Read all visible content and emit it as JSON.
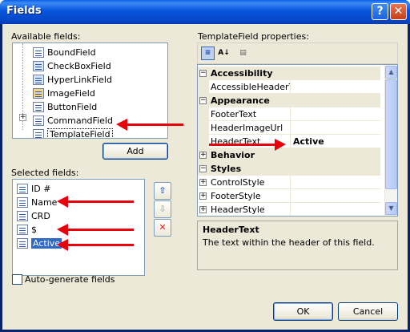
{
  "window": {
    "title": "Fields",
    "help_glyph": "?",
    "close_glyph": "✕"
  },
  "available": {
    "label": "Available fields:",
    "items": [
      {
        "label": "BoundField",
        "icon": "bound-field-icon"
      },
      {
        "label": "CheckBoxField",
        "icon": "checkbox-field-icon"
      },
      {
        "label": "HyperLinkField",
        "icon": "hyperlink-field-icon"
      },
      {
        "label": "ImageField",
        "icon": "image-field-icon"
      },
      {
        "label": "ButtonField",
        "icon": "button-field-icon"
      },
      {
        "label": "CommandField",
        "icon": "command-field-icon"
      },
      {
        "label": "TemplateField",
        "icon": "template-field-icon"
      }
    ],
    "add_button": "Add"
  },
  "selected": {
    "label": "Selected fields:",
    "items": [
      {
        "label": "ID #"
      },
      {
        "label": "Name"
      },
      {
        "label": "CRD"
      },
      {
        "label": "$"
      },
      {
        "label": "Active"
      }
    ],
    "move_up_glyph": "⇧",
    "move_down_glyph": "⇩",
    "delete_glyph": "✕"
  },
  "autogen": {
    "label": "Auto-generate fields",
    "checked": false
  },
  "properties": {
    "label": "TemplateField properties:",
    "toolbar": {
      "categorized_icon": "categorized-icon",
      "alphabetical_icon": "alphabetical-icon",
      "property_pages_icon": "property-pages-icon"
    },
    "rows": [
      {
        "type": "category",
        "name": "Accessibility",
        "expander": "⊟"
      },
      {
        "type": "property",
        "name": "AccessibleHeaderTe",
        "value": ""
      },
      {
        "type": "category",
        "name": "Appearance",
        "expander": "⊟"
      },
      {
        "type": "property",
        "name": "FooterText",
        "value": ""
      },
      {
        "type": "property",
        "name": "HeaderImageUrl",
        "value": ""
      },
      {
        "type": "property",
        "name": "HeaderText",
        "value": "Active"
      },
      {
        "type": "category",
        "name": "Behavior",
        "expander": "⊞"
      },
      {
        "type": "category",
        "name": "Styles",
        "expander": "⊟"
      },
      {
        "type": "property",
        "name": "ControlStyle",
        "value": "",
        "expander": "⊞"
      },
      {
        "type": "property",
        "name": "FooterStyle",
        "value": "",
        "expander": "⊞"
      },
      {
        "type": "property",
        "name": "HeaderStyle",
        "value": "",
        "expander": "⊞"
      }
    ],
    "description": {
      "title": "HeaderText",
      "text": "The text within the header of this field."
    }
  },
  "buttons": {
    "ok": "OK",
    "cancel": "Cancel"
  },
  "colors": {
    "annotation_arrow": "#e8000d",
    "selection": "#316ac5",
    "titlebar": "#0855dd"
  }
}
